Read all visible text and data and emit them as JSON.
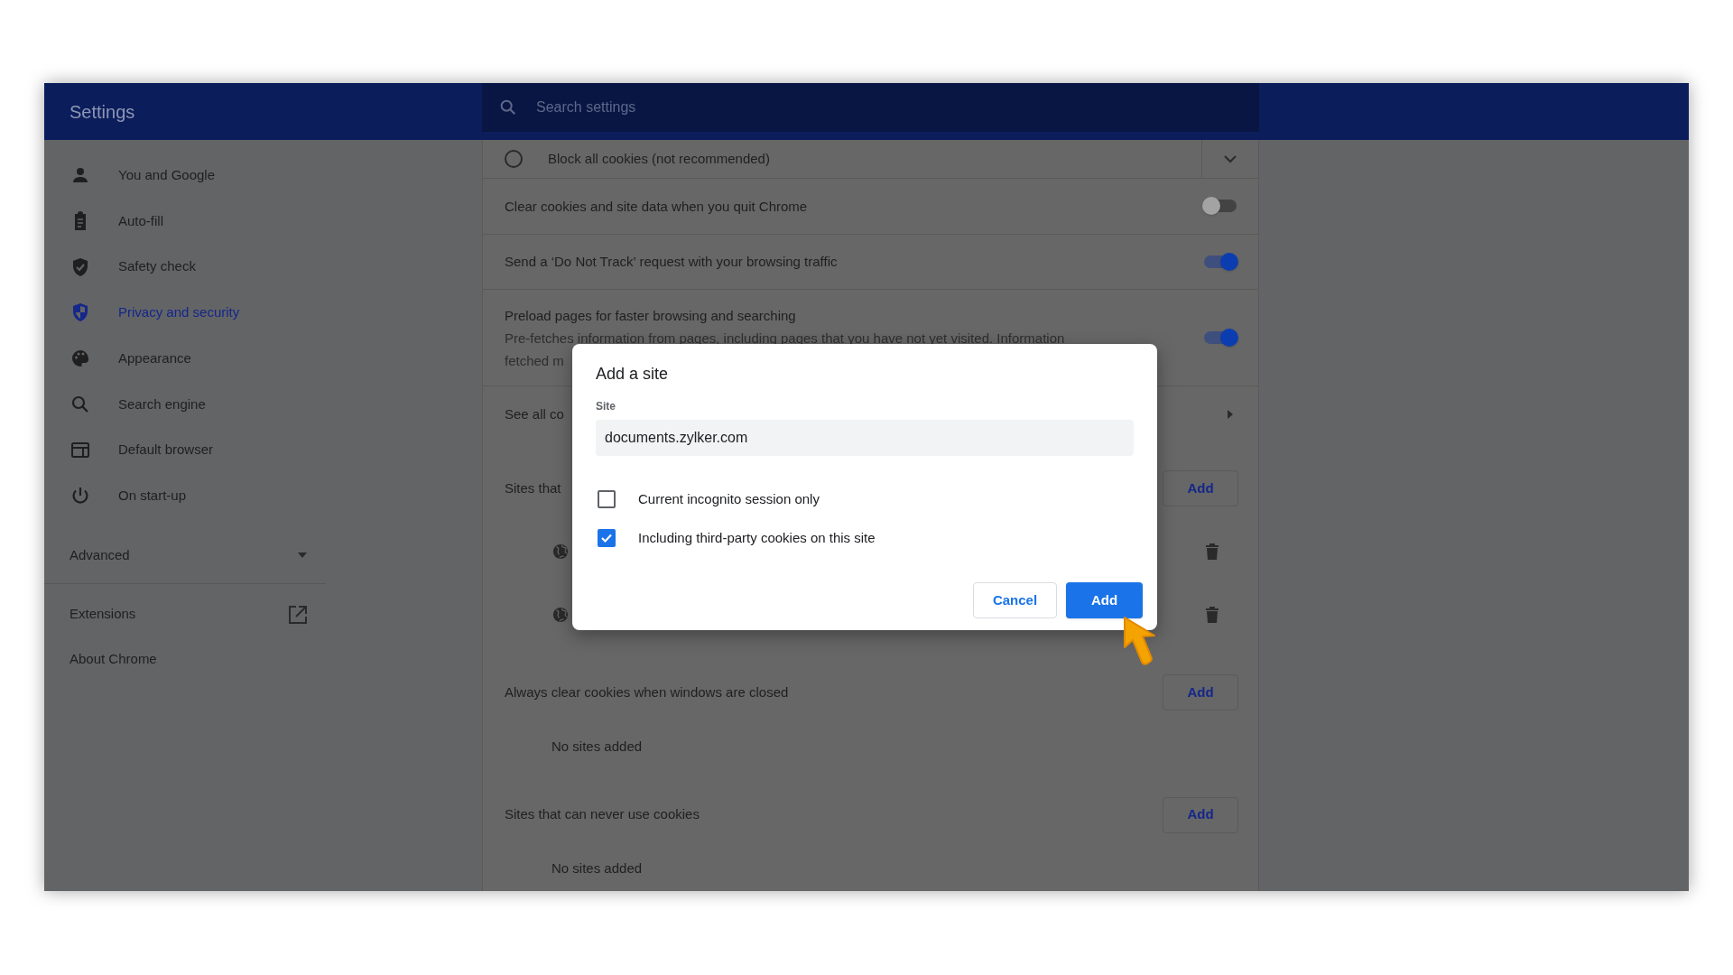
{
  "window": {
    "title": "Settings"
  },
  "search": {
    "placeholder": "Search settings"
  },
  "sidebar": {
    "items": [
      {
        "label": "You and Google",
        "selected": false
      },
      {
        "label": "Auto-fill",
        "selected": false
      },
      {
        "label": "Safety check",
        "selected": false
      },
      {
        "label": "Privacy and security",
        "selected": true
      },
      {
        "label": "Appearance",
        "selected": false
      },
      {
        "label": "Search engine",
        "selected": false
      },
      {
        "label": "Default browser",
        "selected": false
      },
      {
        "label": "On start-up",
        "selected": false
      }
    ],
    "advanced": {
      "label": "Advanced",
      "expanded": false
    },
    "links": [
      {
        "label": "Extensions",
        "external": true
      },
      {
        "label": "About Chrome",
        "external": false
      }
    ]
  },
  "content": {
    "rows": [
      {
        "kind": "radio",
        "label": "Block all cookies (not recommended)",
        "selected": false
      },
      {
        "kind": "toggle",
        "label": "Clear cookies and site data when you quit Chrome",
        "on": false
      },
      {
        "kind": "toggle",
        "label": "Send a ‘Do Not Track’ request with your browsing traffic",
        "on": true
      },
      {
        "kind": "toggle",
        "label": "Preload pages for faster browsing and searching",
        "description_lines": [
          "Pre-fetches information from pages, including pages that you have not yet visited. Information",
          "fetched m"
        ],
        "on": true
      },
      {
        "kind": "link",
        "label": "See all co"
      },
      {
        "kind": "section",
        "label": "Sites that",
        "button": "Add"
      },
      {
        "kind": "site"
      },
      {
        "kind": "site"
      },
      {
        "kind": "section",
        "label": "Always clear cookies when windows are closed",
        "button": "Add"
      },
      {
        "kind": "empty",
        "label": "No sites added"
      },
      {
        "kind": "section",
        "label": "Sites that can never use cookies",
        "button": "Add"
      },
      {
        "kind": "empty",
        "label": "No sites added"
      }
    ]
  },
  "dialog": {
    "title": "Add a site",
    "field_label": "Site",
    "value": "documents.zylker.com",
    "options": [
      {
        "label": "Current incognito session only",
        "checked": false
      },
      {
        "label": "Including third-party cookies on this site",
        "checked": true
      }
    ],
    "buttons": [
      {
        "label": "Cancel",
        "kind": "secondary"
      },
      {
        "label": "Add",
        "kind": "primary"
      }
    ]
  }
}
